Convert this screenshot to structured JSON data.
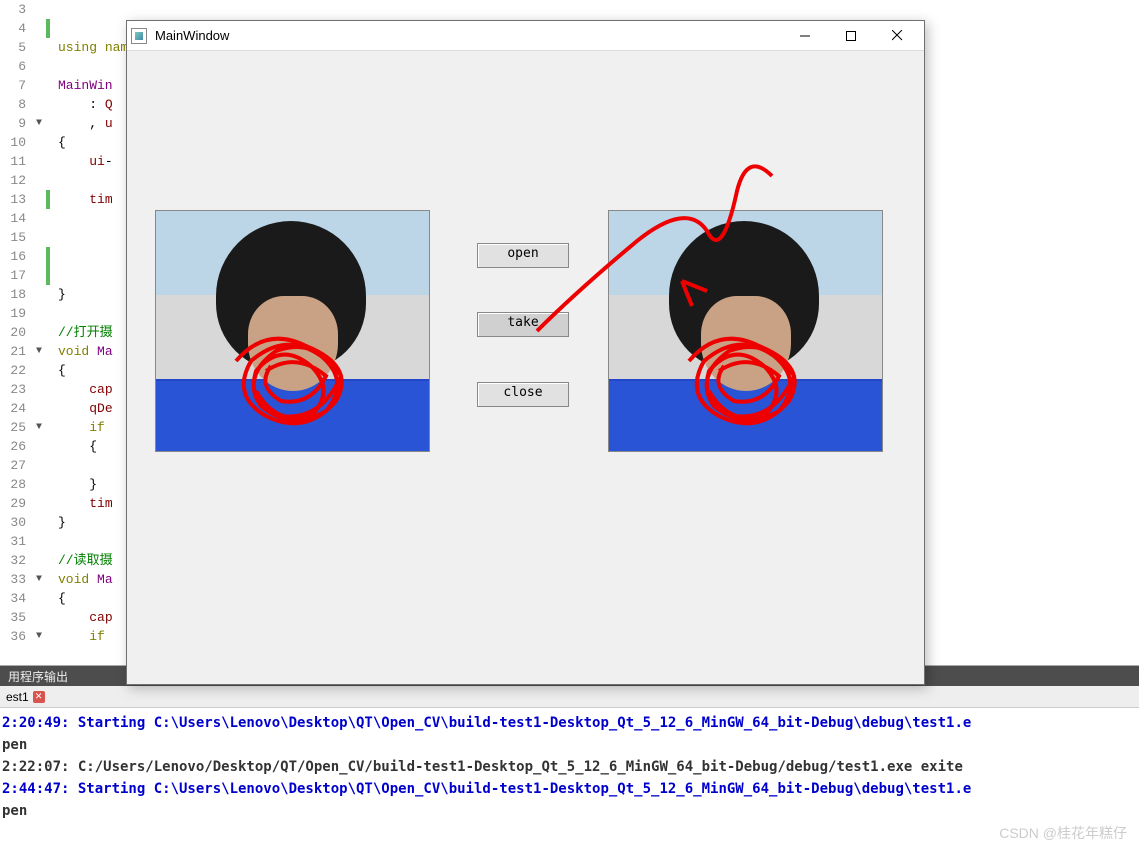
{
  "editor": {
    "line_numbers": [
      3,
      4,
      5,
      6,
      7,
      8,
      9,
      10,
      11,
      12,
      13,
      14,
      15,
      16,
      17,
      18,
      19,
      20,
      21,
      22,
      23,
      24,
      25,
      26,
      27,
      28,
      29,
      30,
      31,
      32,
      33,
      34,
      35,
      36
    ],
    "folds": {
      "9": "▼",
      "21": "▼",
      "25": "▼",
      "33": "▼",
      "36": "▼"
    },
    "green_lines": [
      4,
      13,
      16,
      17
    ],
    "code_lines": [
      "",
      "",
      "using namespace cv;",
      "",
      "MainWin",
      "    : Q",
      "    , u",
      "{",
      "    ui-",
      "",
      "    tim",
      "",
      "",
      "",
      "",
      "}",
      "",
      "//打开摄",
      "void Ma",
      "{",
      "    cap",
      "    qDe",
      "    if",
      "    {",
      "",
      "    }",
      "    tim",
      "}",
      "",
      "//读取摄",
      "void Ma",
      "{",
      "    cap",
      "    if"
    ]
  },
  "mainwindow": {
    "title": "MainWindow",
    "buttons": {
      "open": "open",
      "take": "take",
      "close": "close"
    }
  },
  "output": {
    "header": "用程序输出",
    "tab": "est1",
    "lines": [
      {
        "cls": "out-blue",
        "text": "2:20:49: Starting C:\\Users\\Lenovo\\Desktop\\QT\\Open_CV\\build-test1-Desktop_Qt_5_12_6_MinGW_64_bit-Debug\\debug\\test1.e"
      },
      {
        "cls": "out-dark",
        "text": "pen"
      },
      {
        "cls": "out-dark",
        "text": "2:22:07: C:/Users/Lenovo/Desktop/QT/Open_CV/build-test1-Desktop_Qt_5_12_6_MinGW_64_bit-Debug/debug/test1.exe exite"
      },
      {
        "cls": "out-dark",
        "text": ""
      },
      {
        "cls": "out-blue",
        "text": "2:44:47: Starting C:\\Users\\Lenovo\\Desktop\\QT\\Open_CV\\build-test1-Desktop_Qt_5_12_6_MinGW_64_bit-Debug\\debug\\test1.e"
      },
      {
        "cls": "out-dark",
        "text": "pen"
      }
    ]
  },
  "watermark": "CSDN @桂花年糕仔"
}
